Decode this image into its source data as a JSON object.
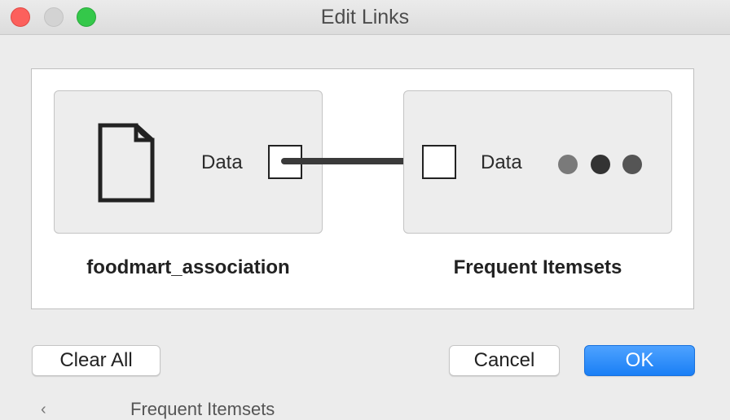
{
  "window": {
    "title": "Edit Links"
  },
  "source_node": {
    "name": "foodmart_association",
    "icon": "file-icon",
    "output_port_label": "Data"
  },
  "target_node": {
    "name": "Frequent Itemsets",
    "icon": "more-dots-icon",
    "input_port_label": "Data"
  },
  "buttons": {
    "clear_all": "Clear All",
    "cancel": "Cancel",
    "ok": "OK"
  },
  "background_window": {
    "text": "Frequent Itemsets"
  },
  "colors": {
    "ok_accent": "#1a7ff5",
    "close": "#fc605c",
    "maximize": "#34c84a"
  }
}
